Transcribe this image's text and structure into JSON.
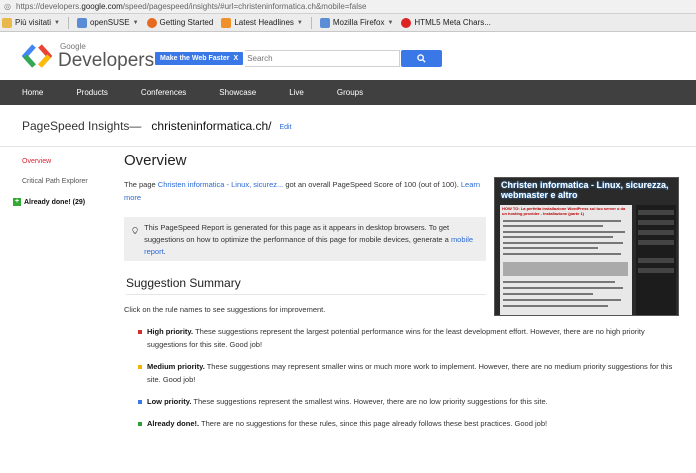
{
  "browser": {
    "url_prefix": "https://developers.",
    "url_domain": "google.com",
    "url_rest": "/speed/pagespeed/insights/#url=christeninformatica.ch&mobile=false",
    "bookmarks": [
      {
        "label": "Più visitati",
        "icon": "star-folder-icon",
        "has_arrow": true
      },
      {
        "label": "openSUSE",
        "icon": "folder-icon",
        "has_arrow": true
      },
      {
        "label": "Getting Started",
        "icon": "firefox-icon",
        "has_arrow": false
      },
      {
        "label": "Latest Headlines",
        "icon": "rss-icon",
        "has_arrow": true
      },
      {
        "label": "Mozilla Firefox",
        "icon": "folder-icon",
        "has_arrow": true
      },
      {
        "label": "HTML5 Meta Chars...",
        "icon": "red-dot-icon",
        "has_arrow": false
      }
    ]
  },
  "header": {
    "logo_small": "Google",
    "logo_big": "Developers",
    "chip_label": "Make the Web Faster",
    "chip_close": "X",
    "search_placeholder": "Search"
  },
  "nav": [
    "Home",
    "Products",
    "Conferences",
    "Showcase",
    "Live",
    "Groups"
  ],
  "crumb": {
    "title": "PageSpeed Insights",
    "dash": "—",
    "site": "christeninformatica.ch/",
    "edit": "Edit"
  },
  "sidebar": {
    "overview": "Overview",
    "critical": "Critical Path Explorer",
    "done": "Already done! (29)"
  },
  "main": {
    "title": "Overview",
    "intro_pre": "The page ",
    "intro_link": "Christen informatica - Linux, sicurez...",
    "intro_mid": " got an overall PageSpeed Score of ",
    "score": "100",
    "intro_post": " (out of 100). ",
    "learn_more": "Learn more",
    "note_text": "This PageSpeed Report is generated for this page as it appears in desktop browsers. To get suggestions on how to optimize the performance of this page for mobile devices, generate a ",
    "note_link": "mobile report",
    "note_end": ".",
    "summary_title": "Suggestion Summary",
    "click_hint": "Click on the rule names to see suggestions for improvement."
  },
  "rules": [
    {
      "color": "#d32f2f",
      "label": "High priority.",
      "text": " These suggestions represent the largest potential performance wins for the least development effort. However, there are no high priority suggestions for this site. Good job!"
    },
    {
      "color": "#f0b400",
      "label": "Medium priority.",
      "text": " These suggestions may represent smaller wins or much more work to implement. However, there are no medium priority suggestions for this site. Good job!"
    },
    {
      "color": "#3b78e7",
      "label": "Low priority.",
      "text": " These suggestions represent the smallest wins. However, there are no low priority suggestions for this site."
    },
    {
      "color": "#2e9e3a",
      "label": "Already done!.",
      "text": " There are no suggestions for these rules, since this page already follows these best practices. Good job!"
    }
  ],
  "thumbnail": {
    "title": "Christen informatica - Linux, sicurezza, webmaster e altro",
    "headline": "HOW TO: La perfetta installazione WordPress sul tuo server o da un hosting provider - Installazione (parte 1)"
  }
}
